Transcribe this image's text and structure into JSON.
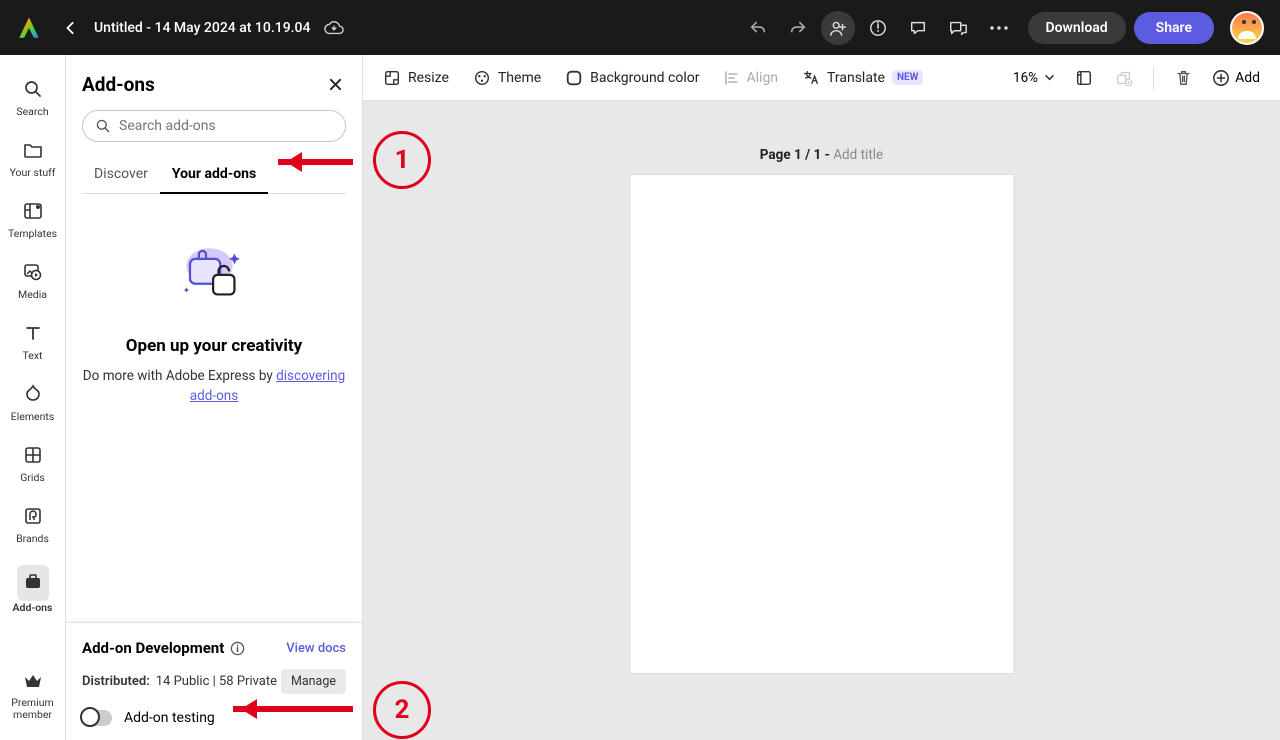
{
  "topbar": {
    "title": "Untitled - 14 May 2024 at 10.19.04",
    "download": "Download",
    "share": "Share"
  },
  "rail": {
    "search": "Search",
    "your_stuff": "Your stuff",
    "templates": "Templates",
    "media": "Media",
    "text": "Text",
    "elements": "Elements",
    "grids": "Grids",
    "brands": "Brands",
    "addons": "Add-ons",
    "premium1": "Premium",
    "premium2": "member"
  },
  "panel": {
    "title": "Add-ons",
    "search_placeholder": "Search add-ons",
    "tab_discover": "Discover",
    "tab_your": "Your add-ons",
    "empty_heading": "Open up your creativity",
    "empty_text": "Do more with Adobe Express by",
    "empty_link": "discovering add-ons",
    "dev_title": "Add-on Development",
    "dev_link": "View docs",
    "dist_label": "Distributed:",
    "dist_value": "14 Public | 58 Private",
    "manage": "Manage",
    "testing_label": "Add-on testing"
  },
  "tools": {
    "resize": "Resize",
    "theme": "Theme",
    "bg": "Background color",
    "align": "Align",
    "translate": "Translate",
    "new_badge": "NEW",
    "zoom": "16%",
    "add": "Add"
  },
  "canvas": {
    "page_label": "Page 1 / 1 -",
    "page_hint": " Add title"
  },
  "callouts": {
    "one": "1",
    "two": "2"
  }
}
